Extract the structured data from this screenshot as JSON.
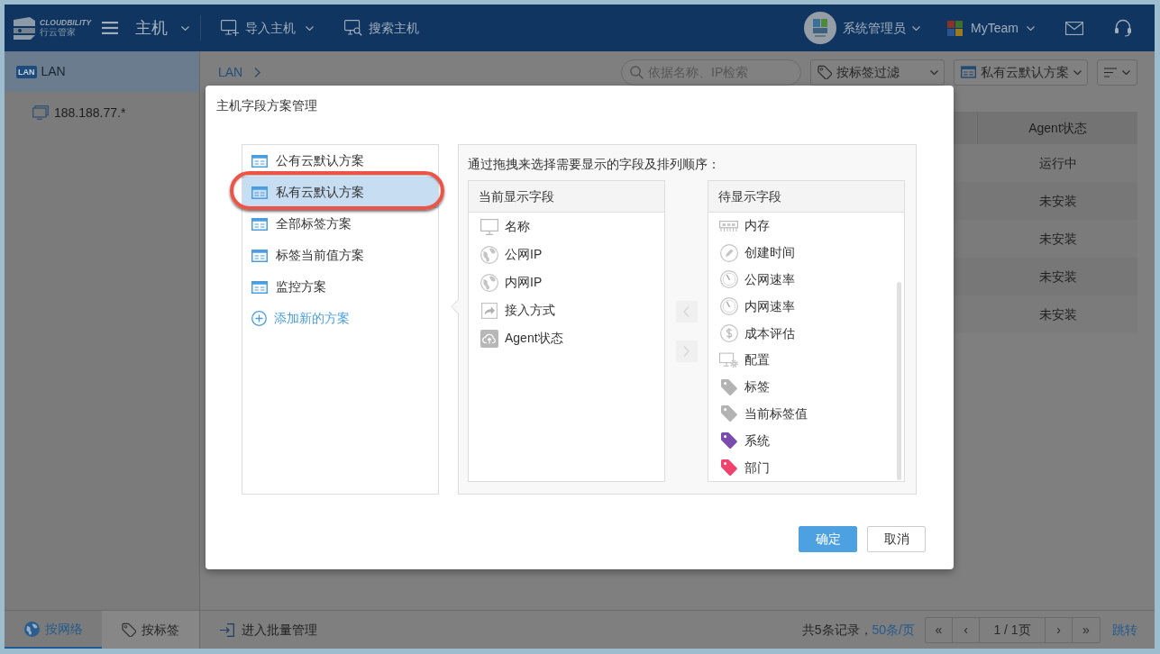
{
  "header": {
    "logo": {
      "brand": "CLOUDBILITY",
      "subtitle": "行云管家"
    },
    "module": "主机",
    "actions": [
      {
        "kind": "import",
        "label": "导入主机",
        "dropdown": true
      },
      {
        "kind": "search",
        "label": "搜索主机",
        "dropdown": false
      }
    ],
    "user": "系统管理员",
    "team": "MyTeam"
  },
  "sidebar": {
    "networks": [
      {
        "badge": "LAN",
        "label": "LAN",
        "selected": true,
        "children": [
          {
            "label": "188.188.77.*",
            "selected": false
          }
        ]
      }
    ],
    "tabs": [
      {
        "kind": "network",
        "label": "按网络",
        "selected": true
      },
      {
        "kind": "tag",
        "label": "按标签",
        "selected": false
      }
    ]
  },
  "toolbar": {
    "breadcrumb": [
      "LAN"
    ],
    "search": {
      "placeholder": "依据名称、IP检索"
    },
    "tag_filter": "按标签过滤",
    "scheme_select": "私有云默认方案"
  },
  "table": {
    "columns": [
      "Agent状态"
    ],
    "rows": [
      [
        "运行中"
      ],
      [
        "未安装"
      ],
      [
        "未安装"
      ],
      [
        "未安装"
      ],
      [
        "未安装"
      ]
    ]
  },
  "footer": {
    "batch_manage": "进入批量管理",
    "record_count": "共5条记录，",
    "page_size": "50条/页",
    "pager": [
      "«",
      "‹",
      "1 / 1页",
      "›",
      "»"
    ],
    "jump": "跳转"
  },
  "modal": {
    "title": "主机字段方案管理",
    "schemes": [
      {
        "label": "公有云默认方案",
        "selected": false,
        "highlighted": false
      },
      {
        "label": "私有云默认方案",
        "selected": true,
        "highlighted": true
      },
      {
        "label": "全部标签方案",
        "selected": false,
        "highlighted": false
      },
      {
        "label": "标签当前值方案",
        "selected": false,
        "highlighted": false
      },
      {
        "label": "监控方案",
        "selected": false,
        "highlighted": false
      }
    ],
    "add_scheme": "添加新的方案",
    "instruction": "通过拖拽来选择需要显示的字段及排列顺序：",
    "shown_fields": {
      "title": "当前显示字段",
      "items": [
        {
          "kind": "monitor",
          "label": "名称"
        },
        {
          "kind": "globe",
          "label": "公网IP"
        },
        {
          "kind": "globe",
          "label": "内网IP"
        },
        {
          "kind": "share",
          "label": "接入方式"
        },
        {
          "kind": "cloud",
          "label": "Agent状态"
        }
      ]
    },
    "transfer_buttons": [
      {
        "kind": "left",
        "disabled": true
      },
      {
        "kind": "right",
        "disabled": true
      }
    ],
    "hidden_fields": {
      "title": "待显示字段",
      "items": [
        {
          "kind": "memory",
          "label": "内存"
        },
        {
          "kind": "pencil",
          "label": "创建时间"
        },
        {
          "kind": "gauge",
          "label": "公网速率"
        },
        {
          "kind": "gauge",
          "label": "内网速率"
        },
        {
          "kind": "dollar",
          "label": "成本评估"
        },
        {
          "kind": "config",
          "label": "配置"
        },
        {
          "kind": "tag",
          "label": "标签",
          "color": "#b3b3b3"
        },
        {
          "kind": "tag",
          "label": "当前标签值",
          "color": "#b3b3b3"
        },
        {
          "kind": "tag",
          "label": "系统",
          "color": "#7a4cb0"
        },
        {
          "kind": "tag",
          "label": "部门",
          "color": "#f2416c"
        }
      ]
    },
    "buttons": [
      {
        "kind": "primary",
        "label": "确定"
      },
      {
        "kind": "default",
        "label": "取消"
      }
    ]
  }
}
